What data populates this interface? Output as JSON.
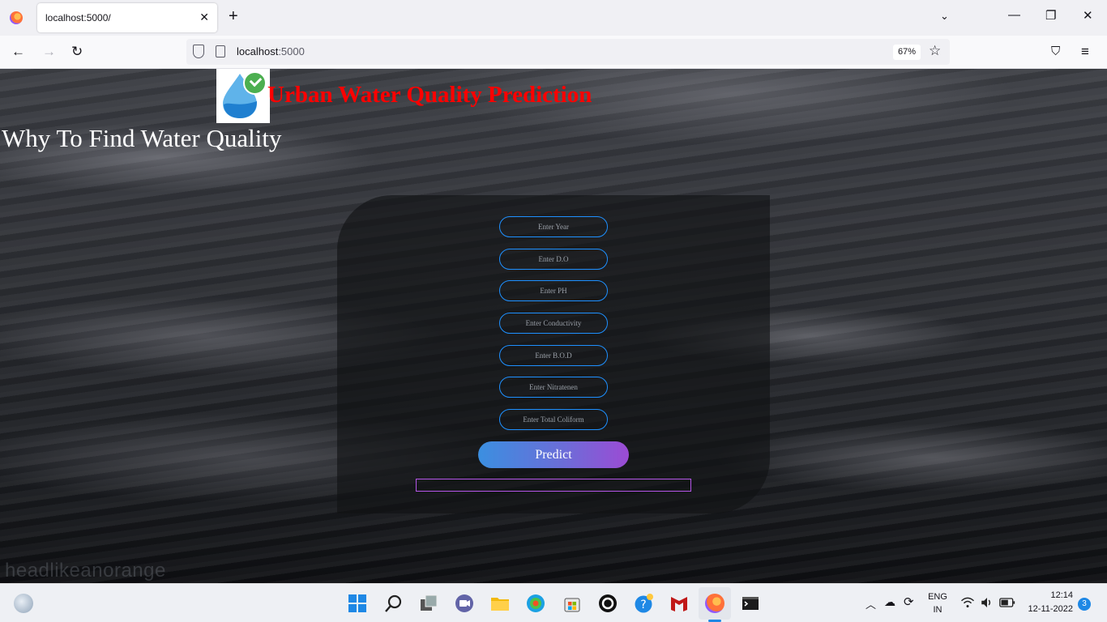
{
  "browser": {
    "tab_title": "localhost:5000/",
    "url_host": "localhost",
    "url_port": ":5000",
    "zoom": "67%"
  },
  "page": {
    "title": "Urban Water Quality Prediction",
    "subtitle": "Why To Find Water Quality",
    "watermark": "headlikeanorange",
    "form": {
      "year_placeholder": "Enter Year",
      "do_placeholder": "Enter D.O",
      "ph_placeholder": "Enter PH",
      "conductivity_placeholder": "Enter Conductivity",
      "bod_placeholder": "Enter B.O.D",
      "nitratenen_placeholder": "Enter Nitratenen",
      "coliform_placeholder": "Enter Total Coliform",
      "predict_label": "Predict",
      "result": ""
    },
    "colors": {
      "title": "#ff0000",
      "field_border": "#1e90ff",
      "button_start": "#3b8fe0",
      "button_end": "#9c4bd4"
    }
  },
  "taskbar": {
    "language": "ENG",
    "region": "IN",
    "time": "12:14",
    "date": "12-11-2022",
    "notifications": "3"
  }
}
